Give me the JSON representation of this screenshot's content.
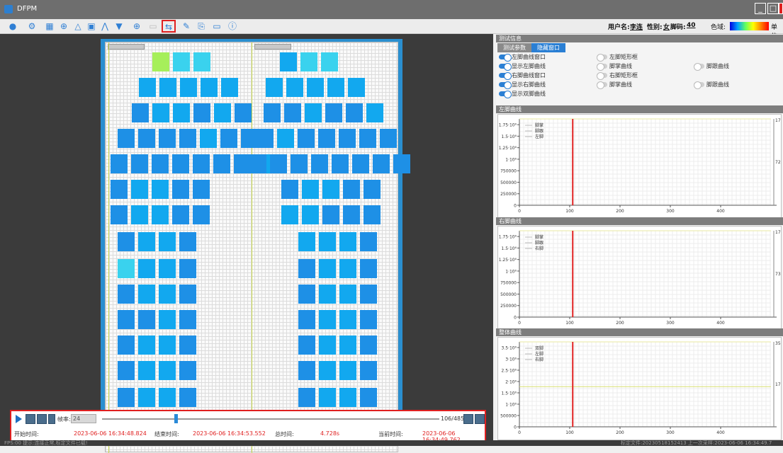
{
  "app": {
    "title": "DFPM"
  },
  "toolbar": {
    "icons": [
      "user-icon",
      "settings-icon",
      "grid-icon",
      "crosshair-icon",
      "foot-icon",
      "image-icon",
      "waveform-icon",
      "funnel-icon",
      "target-icon",
      "blank-icon",
      "swap-icon",
      "brush-icon",
      "export-icon",
      "toggle-icon",
      "info-icon"
    ],
    "user_label": "用户名:",
    "user_value": "李连",
    "gender_label": "性别:",
    "gender_value": "女",
    "shoe_label": "脚码:",
    "shoe_value": "40",
    "color_label": "色域:",
    "unit_label": "单位:"
  },
  "playback": {
    "frame_label": "帧率:",
    "frame_value": "24",
    "count": "106/485",
    "progress": 0.218,
    "start_label": "开始时间:",
    "start_value": "2023-06-06 16:34:48.824",
    "end_label": "结束时间:",
    "end_value": "2023-06-06 16:34:53.552",
    "total_label": "总时间:",
    "total_value": "4.728s",
    "current_label": "当前时间:",
    "current_value": "2023-06-06 16:34:49.762"
  },
  "right": {
    "test_info": "测试信息",
    "tabs": [
      "测试参数",
      "隐藏窗口"
    ],
    "toggles": [
      {
        "label": "左脚曲线窗口",
        "on": true
      },
      {
        "label": "左脚矩形框",
        "on": false
      },
      {
        "label": "显示左脚曲线",
        "on": true
      },
      {
        "label": "脚掌曲线",
        "on": false
      },
      {
        "label": "脚跟曲线",
        "on": false
      },
      {
        "label": "右脚曲线窗口",
        "on": true
      },
      {
        "label": "右脚矩形框",
        "on": false
      },
      {
        "label": "显示右脚曲线",
        "on": true
      },
      {
        "label": "脚掌曲线",
        "on": false
      },
      {
        "label": "脚跟曲线",
        "on": false
      },
      {
        "label": "显示双脚曲线",
        "on": true
      }
    ]
  },
  "chart_data": [
    {
      "type": "line",
      "title": "左脚曲线",
      "legend": [
        "脚掌",
        "脚跟",
        "左脚"
      ],
      "xlim": [
        0,
        500
      ],
      "xticks": [
        "0",
        "100",
        "200",
        "300",
        "400"
      ],
      "ylim": [
        0,
        1900000
      ],
      "yticks": [
        "0",
        "250000",
        "500000",
        "750000",
        "1·10⁶",
        "1.25·10⁶",
        "1.5·10⁶",
        "1.75·10⁶"
      ],
      "marker_x": 106,
      "right_top": "17",
      "right_mid": "72",
      "series": []
    },
    {
      "type": "line",
      "title": "右脚曲线",
      "legend": [
        "脚掌",
        "脚跟",
        "右脚"
      ],
      "xlim": [
        0,
        500
      ],
      "xticks": [
        "0",
        "100",
        "200",
        "300",
        "400"
      ],
      "ylim": [
        0,
        1900000
      ],
      "yticks": [
        "0",
        "250000",
        "500000",
        "750000",
        "1·10⁶",
        "1.25·10⁶",
        "1.5·10⁶",
        "1.75·10⁶"
      ],
      "marker_x": 106,
      "right_top": "17",
      "right_mid": "73",
      "series": []
    },
    {
      "type": "line",
      "title": "整体曲线",
      "legend": [
        "双脚",
        "左脚",
        "右脚"
      ],
      "xlim": [
        0,
        500
      ],
      "xticks": [
        "0",
        "100",
        "200",
        "300",
        "400"
      ],
      "ylim": [
        0,
        3700000
      ],
      "yticks": [
        "0",
        "500000",
        "1·10⁶",
        "1.5·10⁶",
        "2·10⁶",
        "2.5·10⁶",
        "3·10⁶",
        "3.5·10⁶"
      ],
      "marker_x": 106,
      "right_top": "35",
      "right_mid": "17",
      "series": [
        {
          "values": [
            1750000,
            1750000,
            1750000,
            1750000,
            1750000,
            1750000
          ]
        }
      ]
    }
  ],
  "status": {
    "left": "FPS:00   提示:连接正常,标定文件已载!",
    "right": "标定文件:20230518152413   上一次采样:2023-06-06 16:34:49.7"
  }
}
